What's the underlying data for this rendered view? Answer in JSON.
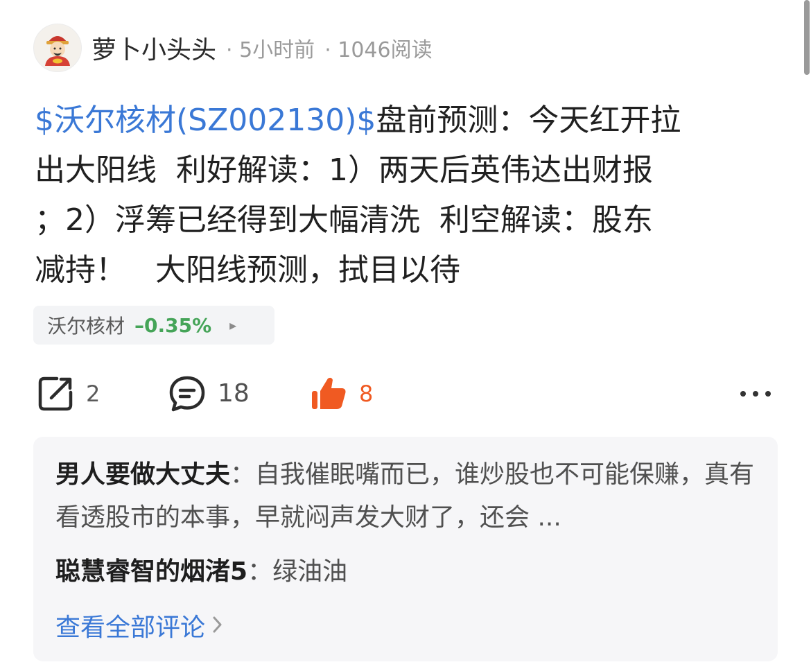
{
  "post": {
    "author": "萝卜小头头",
    "time": "· 5小时前",
    "reads": "· 1046阅读",
    "stock_link": "$沃尔核材(SZ002130)$",
    "body": "盘前预测：今天红开拉\n出大阳线  利好解读：1）两天后英伟达出财报\n；2）浮筹已经得到大幅清洗  利空解读：股东\n减持！   大阳线预测，拭目以待"
  },
  "stock_chip": {
    "name": "沃尔核材",
    "change": "–0.35%",
    "arrow": "▸"
  },
  "actions": {
    "share_count": "2",
    "comment_count": "18",
    "like_count": "8"
  },
  "comments": {
    "items": [
      {
        "author": "男人要做大丈夫",
        "sep": "：",
        "text": "自我催眠嘴而已，谁炒股也不可能保赚，真有看透股市的本事，早就闷声发大财了，还会 ..."
      },
      {
        "author": "聪慧睿智的烟渚5",
        "sep": "：",
        "text": "绿油油"
      }
    ],
    "view_all": "查看全部评论"
  },
  "colors": {
    "link_blue": "#3a78d6",
    "like_orange": "#f05a22",
    "stock_down_green": "#45a458"
  }
}
